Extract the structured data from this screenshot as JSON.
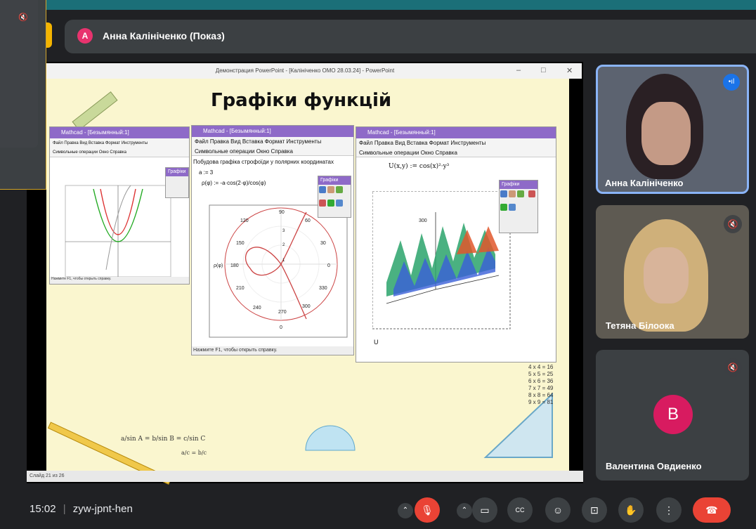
{
  "meeting": {
    "time": "15:02",
    "separator": "|",
    "code": "zyw-jpnt-hen",
    "presenter_initial": "A",
    "presenter_label": "Анна Калініченко (Показ)"
  },
  "powerpoint": {
    "window_title": "Демонстрация PowerPoint - [Калініченко ОМО 28.03.24] - PowerPoint",
    "slide_title": "Графіки функцій",
    "status": "Слайд 21 из 26",
    "min": "–",
    "max": "□",
    "close": "✕"
  },
  "mathcad_left": {
    "title": "Mathcad - [Безымянный:1]",
    "menu": "Файл  Правка  Вид  Вставка  Формат  Инструменты",
    "submenu": "Символьные операции  Окно  Справка",
    "status": "Нажмите F1, чтобы открыть справку."
  },
  "mathcad_mid": {
    "title": "Mathcad - [Безымянный:1]",
    "menu": "Файл  Правка  Вид  Вставка  Формат  Инструменты",
    "submenu": "Символьные операции  Окно  Справка",
    "heading": "Побудова графіка строфоїди у полярних координатах",
    "eq1": "a := 3",
    "eq2": "ρ(φ) := -a·cos(2·φ)/cos(φ)",
    "axis_label": "ρ(φ)",
    "status": "Нажмите F1, чтобы открыть справку."
  },
  "mathcad_right": {
    "title": "Mathcad - [Безымянный:1]",
    "menu": "Файл  Правка  Вид  Вставка  Формат  Инструменты",
    "submenu": "Символьные операции  Окно  Справка",
    "equation": "U(x,y) := cos(x)²·y³",
    "plot_label": "U",
    "axis_value": "300"
  },
  "toolbox": {
    "label": "Графіки"
  },
  "polar_ticks": {
    "t90": "90",
    "t60": "60",
    "t30": "30",
    "t0": "0",
    "t330": "330",
    "t300": "300",
    "t270": "270",
    "t240": "240",
    "t210": "210",
    "t180": "180",
    "t150": "150",
    "t120": "120",
    "r1": "1",
    "r2": "2",
    "r3": "3",
    "bottom": "0"
  },
  "participants": [
    {
      "name": "Анна Калініченко",
      "speaking": true,
      "initial": ""
    },
    {
      "name": "Тетяна Білоока",
      "speaking": false,
      "initial": ""
    },
    {
      "name": "Валентина Овдиенко",
      "speaking": false,
      "initial": "B"
    }
  ],
  "slide_decor": {
    "formula_sine": "a/sin A = b/sin B = c/sin C",
    "formula_small": "a/c = b/c",
    "mult_table": [
      "4 x 4 = 16",
      "5 x 5 = 25",
      "6 x 6 = 36",
      "7 x 7 = 49",
      "8 x 8 = 64",
      "9 x 9 = 81"
    ]
  },
  "colors": {
    "accent_red": "#ea4335",
    "avatar_pink": "#e8336e",
    "avatar_b": "#d81b60",
    "speaking_blue": "#1a73e8",
    "presenter_yellow": "#f4b400"
  }
}
